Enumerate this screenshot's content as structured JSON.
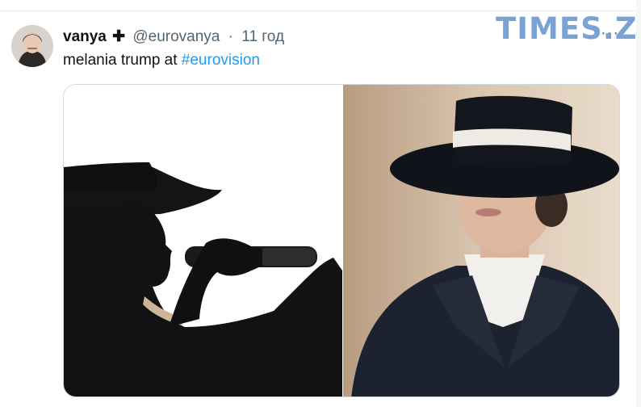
{
  "tweet": {
    "author_name": "vanya",
    "badge": "✚",
    "handle": "@eurovanya",
    "separator": "·",
    "time": "11 год",
    "more_icon": "more-icon",
    "more_glyph": "···",
    "text_plain": "melania trump at ",
    "hashtag": "#eurovision"
  },
  "watermark": {
    "text": "TIMES.ZT"
  },
  "media": {
    "left_image": "silhouette-singer-with-microphone-image",
    "right_image": "woman-in-wide-brim-hat-image"
  },
  "colors": {
    "hashtag": "#1d9bf0",
    "secondary_text": "#536471",
    "watermark": "#6f9bd1"
  }
}
